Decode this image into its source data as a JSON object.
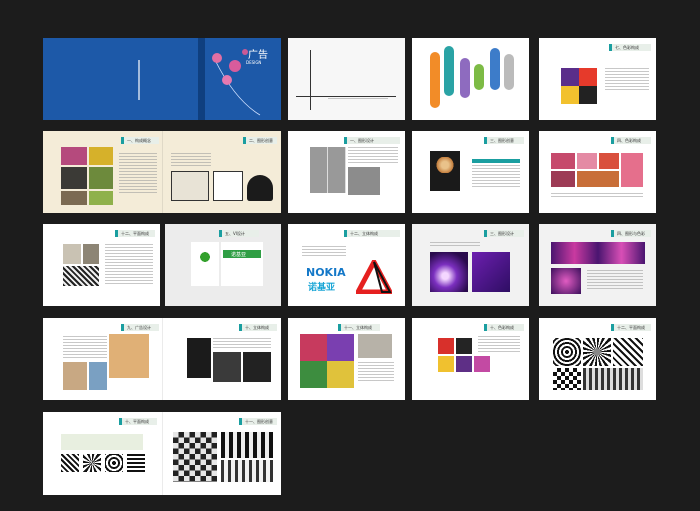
{
  "sheets": [
    {
      "id": "cover",
      "cover_title": "广告",
      "cover_subtitle": "DESIGN"
    },
    {
      "id": "p2"
    },
    {
      "id": "p3"
    },
    {
      "id": "p4",
      "header": "七、色彩构成"
    },
    {
      "id": "p5",
      "header": "一、构成概念"
    },
    {
      "id": "p6",
      "header": "二、图形创意"
    },
    {
      "id": "p7",
      "header": "一、图形设计"
    },
    {
      "id": "p8",
      "header": "三、图形创意"
    },
    {
      "id": "p9",
      "header": "四、色彩构成"
    },
    {
      "id": "p10",
      "header": "十二、平面构成"
    },
    {
      "id": "p11",
      "header": "五、VI设计",
      "logo_text": "诺基亚"
    },
    {
      "id": "p12",
      "header": "十二、立体构成",
      "brand": "NOKIA",
      "brand_cn": "诺基亚"
    },
    {
      "id": "p13",
      "header": "三、图形设计"
    },
    {
      "id": "p14",
      "header": "四、图形与色彩"
    },
    {
      "id": "p15",
      "header": "九、广告设计"
    },
    {
      "id": "p16",
      "header": "十、立体构成"
    },
    {
      "id": "p17",
      "header": "十一、立体构成"
    },
    {
      "id": "p18",
      "header": "十、色彩构成"
    },
    {
      "id": "p19",
      "header": "十二、平面构成"
    },
    {
      "id": "p20",
      "header": "十、平面构成"
    },
    {
      "id": "p21",
      "header": "十一、图形创意"
    }
  ]
}
